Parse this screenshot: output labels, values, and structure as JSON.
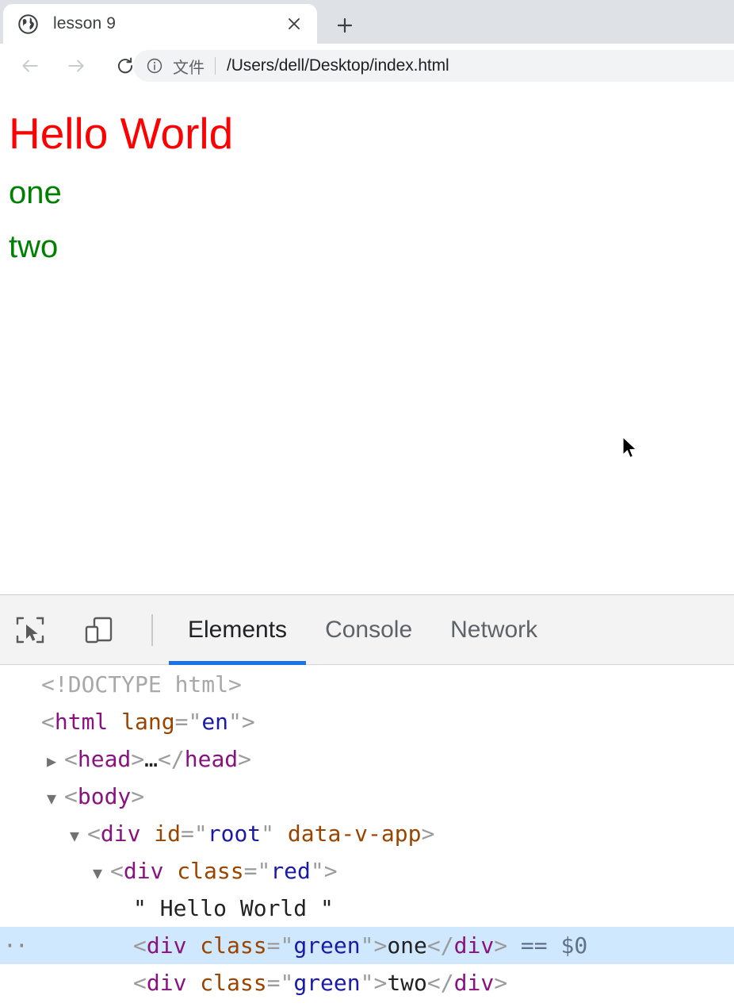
{
  "browser": {
    "tab": {
      "title": "lesson 9",
      "favicon_icon": "globe-icon",
      "close_icon": "close-icon"
    },
    "new_tab_icon": "plus-icon",
    "nav": {
      "back_icon": "arrow-left-icon",
      "forward_icon": "arrow-right-icon",
      "reload_icon": "reload-icon"
    },
    "omnibox": {
      "info_icon": "info-circle-icon",
      "scheme_label": "文件",
      "url": "/Users/dell/Desktop/index.html"
    }
  },
  "page": {
    "heading": "Hello World",
    "heading_color": "#ff0000",
    "lines": [
      {
        "text": "one",
        "color": "#008000"
      },
      {
        "text": "two",
        "color": "#008000"
      }
    ],
    "cursor_icon": "mouse-pointer-icon"
  },
  "devtools": {
    "inspect_icon": "inspect-element-icon",
    "device_toolbar_icon": "device-toolbar-icon",
    "active_tab": "Elements",
    "accent_color": "#1a73e8",
    "tabs": [
      {
        "label": "Elements"
      },
      {
        "label": "Console"
      },
      {
        "label": "Network"
      }
    ],
    "dom": {
      "rows": [
        {
          "id": "doctype",
          "indent": 0,
          "twisty": "none",
          "selected": false,
          "overflow_dots": "",
          "parts": [
            {
              "t": "doctype",
              "v": "<!DOCTYPE html>"
            }
          ]
        },
        {
          "id": "html",
          "indent": 0,
          "twisty": "none",
          "selected": false,
          "overflow_dots": "",
          "parts": [
            {
              "t": "tw",
              "v": "<"
            },
            {
              "t": "tag",
              "v": "html"
            },
            {
              "t": "tw",
              "v": " "
            },
            {
              "t": "attrn",
              "v": "lang"
            },
            {
              "t": "tw",
              "v": "=\""
            },
            {
              "t": "attrv",
              "v": "en"
            },
            {
              "t": "tw",
              "v": "\">"
            }
          ]
        },
        {
          "id": "head",
          "indent": 1,
          "twisty": "collapsed",
          "selected": false,
          "overflow_dots": "",
          "parts": [
            {
              "t": "tw",
              "v": "<"
            },
            {
              "t": "tag",
              "v": "head"
            },
            {
              "t": "tw",
              "v": ">"
            },
            {
              "t": "txt",
              "v": "…"
            },
            {
              "t": "tw",
              "v": "</"
            },
            {
              "t": "tag",
              "v": "head"
            },
            {
              "t": "tw",
              "v": ">"
            }
          ]
        },
        {
          "id": "body",
          "indent": 1,
          "twisty": "expanded",
          "selected": false,
          "overflow_dots": "",
          "parts": [
            {
              "t": "tw",
              "v": "<"
            },
            {
              "t": "tag",
              "v": "body"
            },
            {
              "t": "tw",
              "v": ">"
            }
          ]
        },
        {
          "id": "div-root",
          "indent": 2,
          "twisty": "expanded",
          "selected": false,
          "overflow_dots": "",
          "parts": [
            {
              "t": "tw",
              "v": "<"
            },
            {
              "t": "tag",
              "v": "div"
            },
            {
              "t": "tw",
              "v": " "
            },
            {
              "t": "attrn",
              "v": "id"
            },
            {
              "t": "tw",
              "v": "=\""
            },
            {
              "t": "attrv",
              "v": "root"
            },
            {
              "t": "tw",
              "v": "\" "
            },
            {
              "t": "attrn",
              "v": "data-v-app"
            },
            {
              "t": "tw",
              "v": ">"
            }
          ]
        },
        {
          "id": "div-red",
          "indent": 3,
          "twisty": "expanded",
          "selected": false,
          "overflow_dots": "",
          "parts": [
            {
              "t": "tw",
              "v": "<"
            },
            {
              "t": "tag",
              "v": "div"
            },
            {
              "t": "tw",
              "v": " "
            },
            {
              "t": "attrn",
              "v": "class"
            },
            {
              "t": "tw",
              "v": "=\""
            },
            {
              "t": "attrv",
              "v": "red"
            },
            {
              "t": "tw",
              "v": "\">"
            }
          ]
        },
        {
          "id": "text-hello",
          "indent": 4,
          "twisty": "none",
          "selected": false,
          "overflow_dots": "",
          "parts": [
            {
              "t": "txt",
              "v": "\" Hello World \""
            }
          ]
        },
        {
          "id": "div-green-one",
          "indent": 4,
          "twisty": "none",
          "selected": true,
          "overflow_dots": "··",
          "parts": [
            {
              "t": "tw",
              "v": "<"
            },
            {
              "t": "tag",
              "v": "div"
            },
            {
              "t": "tw",
              "v": " "
            },
            {
              "t": "attrn",
              "v": "class"
            },
            {
              "t": "tw",
              "v": "=\""
            },
            {
              "t": "attrv",
              "v": "green"
            },
            {
              "t": "tw",
              "v": "\">"
            },
            {
              "t": "txt",
              "v": "one"
            },
            {
              "t": "tw",
              "v": "</"
            },
            {
              "t": "tag",
              "v": "div"
            },
            {
              "t": "tw",
              "v": ">"
            },
            {
              "t": "eq0",
              "v": " == $0"
            }
          ]
        },
        {
          "id": "div-green-two",
          "indent": 4,
          "twisty": "none",
          "selected": false,
          "overflow_dots": "",
          "parts": [
            {
              "t": "tw",
              "v": "<"
            },
            {
              "t": "tag",
              "v": "div"
            },
            {
              "t": "tw",
              "v": " "
            },
            {
              "t": "attrn",
              "v": "class"
            },
            {
              "t": "tw",
              "v": "=\""
            },
            {
              "t": "attrv",
              "v": "green"
            },
            {
              "t": "tw",
              "v": "\">"
            },
            {
              "t": "txt",
              "v": "two"
            },
            {
              "t": "tw",
              "v": "</"
            },
            {
              "t": "tag",
              "v": "div"
            },
            {
              "t": "tw",
              "v": ">"
            }
          ]
        }
      ]
    }
  }
}
